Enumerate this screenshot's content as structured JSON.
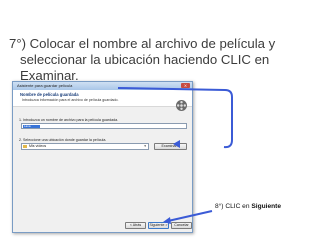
{
  "instruction": {
    "line1": "7°) Colocar el nombre al archivo de película y",
    "line2": "seleccionar la ubicación haciendo CLIC en",
    "line3": "Examinar."
  },
  "dialog": {
    "title": "Asistente para guardar película",
    "close_label": "X",
    "header": "Nombre de película guardada",
    "subheader": "Introduzca información para el archivo de película guardado.",
    "step1_label": "1. Introduzca un nombre de archivo para la película guardada.",
    "filename_value": "Lava",
    "step2_label": "2. Seleccione una ubicación donde guardar la película.",
    "location_value": "Mis vídeos",
    "browse_label": "Examinar...",
    "back_label": "< Atrás",
    "next_label": "Siguiente >",
    "cancel_label": "Cancelar"
  },
  "note": {
    "prefix": "8°) CLIC en ",
    "emphasis": "Siguiente"
  },
  "colors": {
    "arrow": "#3b5bd6",
    "text": "#3c3c3c"
  }
}
